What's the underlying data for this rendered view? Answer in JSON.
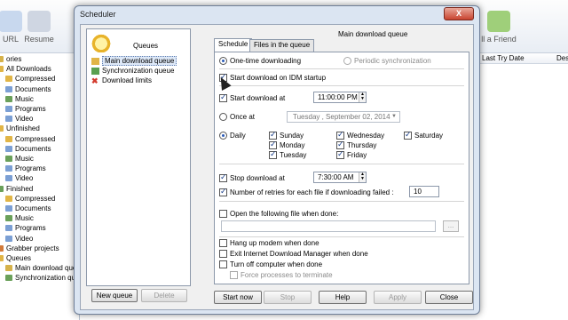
{
  "background": {
    "toolbar": [
      {
        "label": "URL",
        "x": 0
      },
      {
        "label": "Resume",
        "x": 22
      }
    ],
    "toolbar_right_label": "ll a Friend",
    "tree": [
      {
        "label": "ories",
        "indent": 0,
        "color": "#d6b24a"
      },
      {
        "label": "All Downloads",
        "indent": 0,
        "color": "#e1b546"
      },
      {
        "label": "Compressed",
        "indent": 10,
        "color": "#e1b546"
      },
      {
        "label": "Documents",
        "indent": 10,
        "color": "#7b9fd4"
      },
      {
        "label": "Music",
        "indent": 10,
        "color": "#6aa05a"
      },
      {
        "label": "Programs",
        "indent": 10,
        "color": "#7b9fd4"
      },
      {
        "label": "Video",
        "indent": 10,
        "color": "#7b9fd4"
      },
      {
        "label": "Unfinished",
        "indent": 0,
        "color": "#e1b546"
      },
      {
        "label": "Compressed",
        "indent": 10,
        "color": "#e1b546"
      },
      {
        "label": "Documents",
        "indent": 10,
        "color": "#7b9fd4"
      },
      {
        "label": "Music",
        "indent": 10,
        "color": "#6aa05a"
      },
      {
        "label": "Programs",
        "indent": 10,
        "color": "#7b9fd4"
      },
      {
        "label": "Video",
        "indent": 10,
        "color": "#7b9fd4"
      },
      {
        "label": "Finished",
        "indent": 0,
        "color": "#6aa05a"
      },
      {
        "label": "Compressed",
        "indent": 10,
        "color": "#e1b546"
      },
      {
        "label": "Documents",
        "indent": 10,
        "color": "#7b9fd4"
      },
      {
        "label": "Music",
        "indent": 10,
        "color": "#6aa05a"
      },
      {
        "label": "Programs",
        "indent": 10,
        "color": "#7b9fd4"
      },
      {
        "label": "Video",
        "indent": 10,
        "color": "#7b9fd4"
      },
      {
        "label": "Grabber projects",
        "indent": 0,
        "color": "#d27a3a"
      },
      {
        "label": "Queues",
        "indent": 0,
        "color": "#e1b546"
      },
      {
        "label": "Main download queu",
        "indent": 10,
        "color": "#d6b24a"
      },
      {
        "label": "Synchronization qu",
        "indent": 10,
        "color": "#6aa05a"
      }
    ],
    "columns": [
      {
        "label": "Last Try Date",
        "x": 0,
        "w": 84
      },
      {
        "label": "Desc",
        "x": 84,
        "w": 30
      }
    ]
  },
  "dialog": {
    "title": "Scheduler",
    "close_label": "X",
    "queues_title": "Queues",
    "queue_items": [
      {
        "label": "Main download queue",
        "selected": true,
        "color": "#e1b546"
      },
      {
        "label": "Synchronization queue",
        "selected": false,
        "color": "#5aa04f"
      },
      {
        "label": "Download limits",
        "selected": false,
        "color": "#d33a2c"
      }
    ],
    "new_queue_label": "New queue",
    "delete_label": "Delete",
    "panel_title": "Main download queue",
    "tabs": [
      "Schedule",
      "Files in the queue"
    ],
    "one_time_label": "One-time downloading",
    "periodic_label": "Periodic synchronization",
    "startup_label": "Start download on IDM startup",
    "start_at_label": "Start download at",
    "start_time": "11:00:00 PM",
    "once_at_label": "Once at",
    "once_date": "Tuesday  , September 02, 2014",
    "daily_label": "Daily",
    "days": [
      {
        "label": "Sunday",
        "checked": true
      },
      {
        "label": "Monday",
        "checked": true
      },
      {
        "label": "Tuesday",
        "checked": true
      },
      {
        "label": "Wednesday",
        "checked": true
      },
      {
        "label": "Thursday",
        "checked": true
      },
      {
        "label": "Friday",
        "checked": true
      },
      {
        "label": "Saturday",
        "checked": true
      }
    ],
    "stop_at_label": "Stop download at",
    "stop_time": "7:30:00 AM",
    "retries_label": "Number of retries for each file if downloading failed :",
    "retries_value": "10",
    "open_file_label": "Open the following file when done:",
    "hangup_label": "Hang up modem when done",
    "exit_label": "Exit Internet Download Manager when done",
    "turnoff_label": "Turn off computer when done",
    "force_label": "Force processes to terminate",
    "browse_label": "...",
    "buttons": {
      "start_now": "Start now",
      "stop": "Stop",
      "help": "Help",
      "apply": "Apply",
      "close": "Close"
    }
  }
}
